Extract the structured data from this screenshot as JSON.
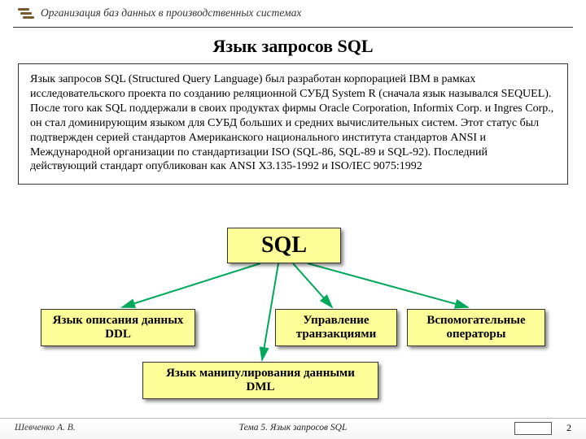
{
  "header": {
    "course": "Организация баз данных в производственных системах"
  },
  "title": "Язык запросов SQL",
  "body": "Язык запросов SQL (Structured Query Language) был разработан корпорацией IBM в рамках исследовательского проекта по созданию реляционной СУБД System R (сначала язык назывался SEQUEL). После того как SQL поддержали в своих продуктах фирмы Oracle Corporation, Informix Corp. и Ingres Corp., он стал доминирующим языком для СУБД больших и средних вычислительных систем. Этот статус был подтвержден серией стандартов Американского национального института стандартов ANSI и Международной организации по стандартизации ISO (SQL-86, SQL-89 и SQL-92). Последний действующий стандарт опубликован как ANSI X3.135-1992 и ISO/IEC 9075:1992",
  "diagram": {
    "root": "SQL",
    "ddl_l1": "Язык описания данных",
    "ddl_l2": "DDL",
    "txn_l1": "Управление",
    "txn_l2": "транзакциями",
    "aux_l1": "Вспомогательные",
    "aux_l2": "операторы",
    "dml_l1": "Язык манипулирования данными",
    "dml_l2": "DML"
  },
  "footer": {
    "author": "Шевченко А. В.",
    "topic": "Тема 5. Язык запросов SQL",
    "page": "2"
  }
}
